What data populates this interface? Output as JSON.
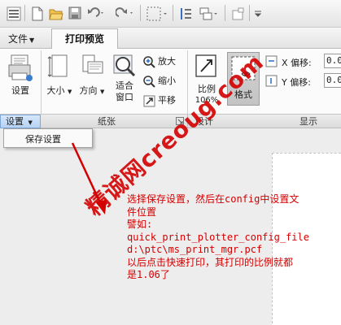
{
  "tabs": {
    "file": "文件",
    "active": "打印预览"
  },
  "ribbon": {
    "settings": "设置",
    "size": "大小",
    "orientation": "方向",
    "fit_line1": "适合",
    "fit_line2": "窗口",
    "zoom_in": "放大",
    "zoom_out": "缩小",
    "pan": "平移",
    "scale": "比例",
    "scale_value": "106%",
    "format": "格式",
    "x_offset_label": "X 偏移:",
    "x_offset_value": "0.0",
    "y_offset_label": "Y 偏移:",
    "y_offset_value": "0.0"
  },
  "groups": {
    "settings": "设置",
    "paper": "纸张",
    "settings2": "设计",
    "display": "显示"
  },
  "menu": {
    "save_settings": "保存设置"
  },
  "annotation": {
    "lines": [
      "选择保存设置，然后在config中设置文",
      "件位置",
      "譬如:",
      "quick_print_plotter_config_file",
      "d:\\ptc\\ms_print_mgr.pcf",
      "以后点击快速打印，其打印的比例就都",
      "是1.06了"
    ]
  },
  "watermark": "精诚网creoug.com",
  "colors": {
    "annotation": "#d40000",
    "active_group": "#b6d2f3"
  }
}
